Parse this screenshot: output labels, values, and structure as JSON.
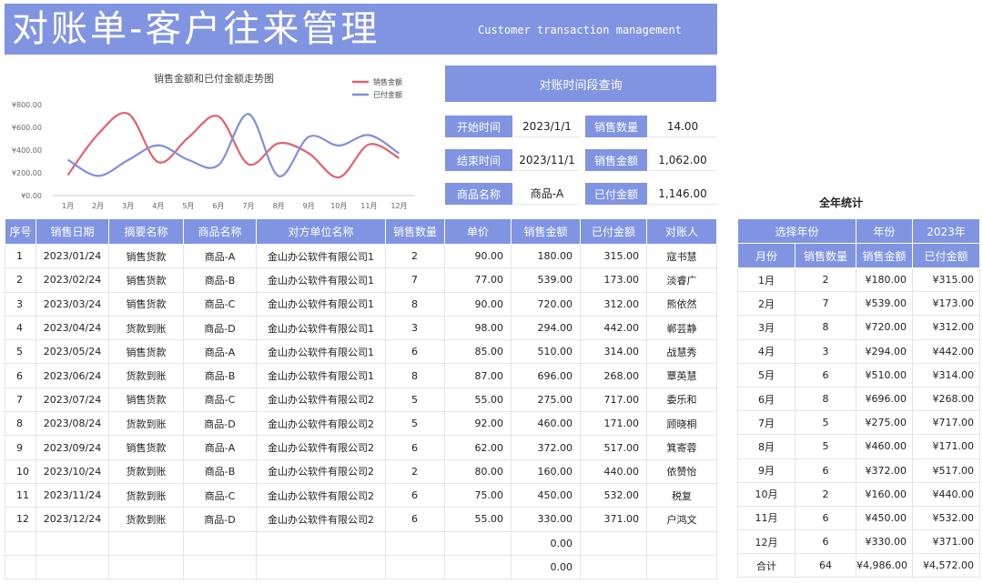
{
  "banner": {
    "title": "对账单-客户往来管理",
    "subtitle": "Customer transaction management"
  },
  "chart_data": {
    "type": "line",
    "title": "销售金额和已付金额走势图",
    "categories": [
      "1月",
      "2月",
      "3月",
      "4月",
      "5月",
      "6月",
      "7月",
      "8月",
      "9月",
      "10月",
      "11月",
      "12月"
    ],
    "series": [
      {
        "name": "销售金额",
        "values": [
          180,
          539,
          720,
          294,
          510,
          696,
          275,
          460,
          372,
          160,
          450,
          330
        ],
        "color": "#e0616f"
      },
      {
        "name": "已付金额",
        "values": [
          315,
          173,
          312,
          442,
          314,
          268,
          717,
          171,
          517,
          440,
          532,
          371
        ],
        "color": "#7f8fd8"
      }
    ],
    "yticks": [
      "¥0.00",
      "¥200.00",
      "¥400.00",
      "¥600.00",
      "¥800.00"
    ],
    "ylim": [
      0,
      800
    ],
    "legend": "top-right"
  },
  "query": {
    "header": "对账时间段查询",
    "start_label": "开始时间",
    "start_value": "2023/1/1",
    "end_label": "结束时间",
    "end_value": "2023/11/1",
    "product_label": "商品名称",
    "product_value": "商品-A",
    "qty_label": "销售数量",
    "qty_value": "14.00",
    "amount_label": "销售金额",
    "amount_value": "1,062.00",
    "paid_label": "已付金额",
    "paid_value": "1,146.00"
  },
  "main_table": {
    "headers": [
      "序号",
      "销售日期",
      "摘要名称",
      "商品名称",
      "对方单位名称",
      "销售数量",
      "单价",
      "销售金额",
      "已付金额",
      "对账人"
    ],
    "rows": [
      [
        "1",
        "2023/01/24",
        "销售货款",
        "商品-A",
        "金山办公软件有限公司1",
        "2",
        "90.00",
        "180.00",
        "315.00",
        "寇书慧"
      ],
      [
        "2",
        "2023/02/24",
        "销售货款",
        "商品-B",
        "金山办公软件有限公司1",
        "7",
        "77.00",
        "539.00",
        "173.00",
        "淡睿广"
      ],
      [
        "3",
        "2023/03/24",
        "销售货款",
        "商品-C",
        "金山办公软件有限公司1",
        "8",
        "90.00",
        "720.00",
        "312.00",
        "熊依然"
      ],
      [
        "4",
        "2023/04/24",
        "货款到账",
        "商品-D",
        "金山办公软件有限公司1",
        "3",
        "98.00",
        "294.00",
        "442.00",
        "郸芸静"
      ],
      [
        "5",
        "2023/05/24",
        "销售货款",
        "商品-A",
        "金山办公软件有限公司1",
        "6",
        "85.00",
        "510.00",
        "314.00",
        "战慧秀"
      ],
      [
        "6",
        "2023/06/24",
        "货款到账",
        "商品-B",
        "金山办公软件有限公司1",
        "8",
        "87.00",
        "696.00",
        "268.00",
        "覃英慧"
      ],
      [
        "7",
        "2023/07/24",
        "销售货款",
        "商品-C",
        "金山办公软件有限公司2",
        "5",
        "55.00",
        "275.00",
        "717.00",
        "委乐和"
      ],
      [
        "8",
        "2023/08/24",
        "货款到账",
        "商品-D",
        "金山办公软件有限公司2",
        "5",
        "92.00",
        "460.00",
        "171.00",
        "顾晓桐"
      ],
      [
        "9",
        "2023/09/24",
        "销售货款",
        "商品-A",
        "金山办公软件有限公司2",
        "6",
        "62.00",
        "372.00",
        "517.00",
        "箕寄蓉"
      ],
      [
        "10",
        "2023/10/24",
        "货款到账",
        "商品-B",
        "金山办公软件有限公司2",
        "2",
        "80.00",
        "160.00",
        "440.00",
        "依赞怡"
      ],
      [
        "11",
        "2023/11/24",
        "货款到账",
        "商品-C",
        "金山办公软件有限公司2",
        "6",
        "75.00",
        "450.00",
        "532.00",
        "税复"
      ],
      [
        "12",
        "2023/12/24",
        "货款到账",
        "商品-D",
        "金山办公软件有限公司2",
        "6",
        "55.00",
        "330.00",
        "371.00",
        "户鸿文"
      ],
      [
        "",
        "",
        "",
        "",
        "",
        "",
        "",
        "0.00",
        "",
        ""
      ],
      [
        "",
        "",
        "",
        "",
        "",
        "",
        "",
        "0.00",
        "",
        ""
      ]
    ]
  },
  "year_stats": {
    "title": "全年统计",
    "select_label": "选择年份",
    "year_label": "年份",
    "year_value": "2023年",
    "headers": [
      "月份",
      "销售数量",
      "销售金额",
      "已付金额"
    ],
    "rows": [
      [
        "1月",
        "2",
        "¥180.00",
        "¥315.00"
      ],
      [
        "2月",
        "7",
        "¥539.00",
        "¥173.00"
      ],
      [
        "3月",
        "8",
        "¥720.00",
        "¥312.00"
      ],
      [
        "4月",
        "3",
        "¥294.00",
        "¥442.00"
      ],
      [
        "5月",
        "6",
        "¥510.00",
        "¥314.00"
      ],
      [
        "6月",
        "8",
        "¥696.00",
        "¥268.00"
      ],
      [
        "7月",
        "5",
        "¥275.00",
        "¥717.00"
      ],
      [
        "8月",
        "5",
        "¥460.00",
        "¥171.00"
      ],
      [
        "9月",
        "6",
        "¥372.00",
        "¥517.00"
      ],
      [
        "10月",
        "2",
        "¥160.00",
        "¥440.00"
      ],
      [
        "11月",
        "6",
        "¥450.00",
        "¥532.00"
      ],
      [
        "12月",
        "6",
        "¥330.00",
        "¥371.00"
      ]
    ],
    "total": [
      "合计",
      "64",
      "¥4,986.00",
      "¥4,572.00"
    ]
  }
}
